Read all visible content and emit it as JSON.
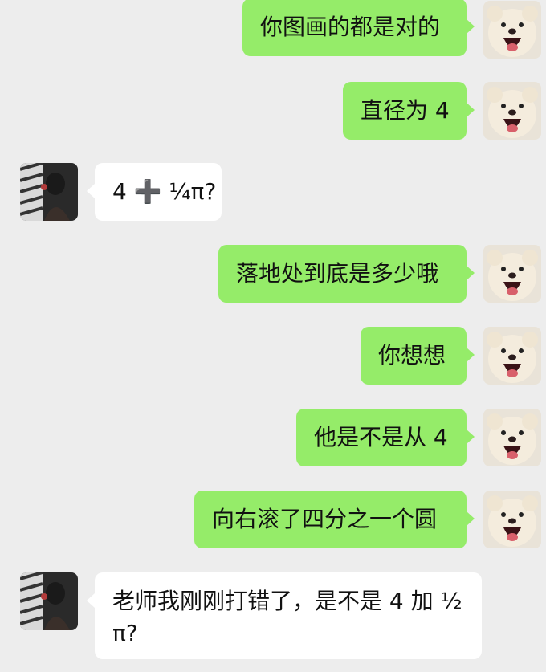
{
  "messages": [
    {
      "side": "mine",
      "text": "你图画的都是对的"
    },
    {
      "side": "mine",
      "text": "直径为 4"
    },
    {
      "side": "theirs",
      "text": "4 ➕ ¼π?"
    },
    {
      "side": "mine",
      "text": "落地处到底是多少哦"
    },
    {
      "side": "mine",
      "text": "你想想"
    },
    {
      "side": "mine",
      "text": "他是不是从 4"
    },
    {
      "side": "mine",
      "text": "向右滚了四分之一个圆"
    },
    {
      "side": "theirs",
      "text": "老师我刚刚打错了，是不是 4 加 ½ π?"
    }
  ],
  "avatars": {
    "mine": "puppy-avatar",
    "theirs": "student-avatar"
  }
}
